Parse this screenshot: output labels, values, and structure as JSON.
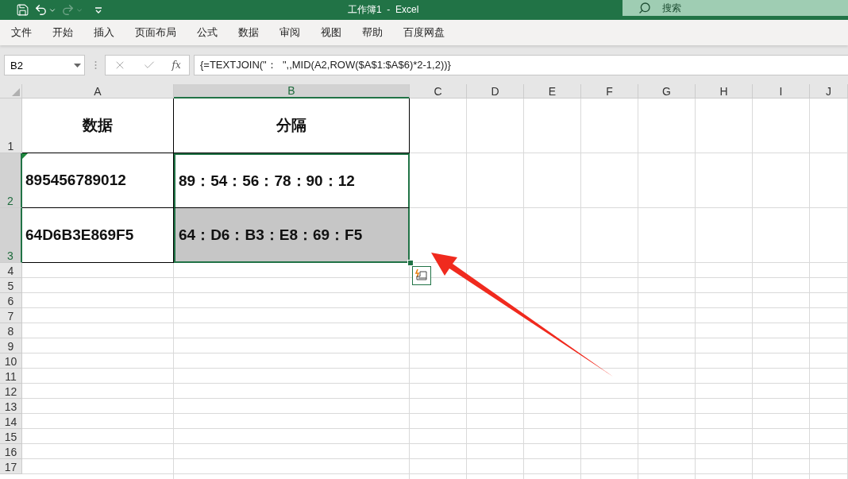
{
  "title_bar": {
    "title": "工作簿1  -  Excel",
    "search_placeholder": "搜索",
    "redo_disabled": true
  },
  "menu": [
    {
      "label": "文件"
    },
    {
      "label": "开始"
    },
    {
      "label": "插入"
    },
    {
      "label": "页面布局"
    },
    {
      "label": "公式"
    },
    {
      "label": "数据"
    },
    {
      "label": "审阅"
    },
    {
      "label": "视图"
    },
    {
      "label": "帮助"
    },
    {
      "label": "百度网盘"
    }
  ],
  "formula_bar": {
    "name_box": "B2",
    "fx": "fx",
    "formula": "{=TEXTJOIN(\"：  \",,MID(A2,ROW($A$1:$A$6)*2-1,2))}"
  },
  "columns": [
    {
      "label": "A",
      "selected": false
    },
    {
      "label": "B",
      "selected": true
    },
    {
      "label": "C",
      "selected": false
    },
    {
      "label": "D",
      "selected": false
    },
    {
      "label": "E",
      "selected": false
    },
    {
      "label": "F",
      "selected": false
    },
    {
      "label": "G",
      "selected": false
    },
    {
      "label": "H",
      "selected": false
    },
    {
      "label": "I",
      "selected": false
    },
    {
      "label": "J",
      "selected": false
    }
  ],
  "rows": [
    {
      "label": "1",
      "selected": false,
      "cells": [
        {
          "text": "数据",
          "kind": "heading",
          "selected": false,
          "shaded": false,
          "flag": false
        },
        {
          "text": "分隔",
          "kind": "heading",
          "selected": false,
          "shaded": false,
          "flag": false
        }
      ]
    },
    {
      "label": "2",
      "selected": true,
      "cells": [
        {
          "text": "895456789012",
          "kind": "value",
          "selected": false,
          "shaded": false,
          "flag": true
        },
        {
          "text": "89：54：56：78：90：12",
          "kind": "value",
          "selected": true,
          "shaded": false,
          "flag": false
        }
      ]
    },
    {
      "label": "3",
      "selected": true,
      "cells": [
        {
          "text": "64D6B3E869F5",
          "kind": "value",
          "selected": false,
          "shaded": false,
          "flag": false
        },
        {
          "text": "64：D6：B3：E8：69：F5",
          "kind": "value",
          "selected": true,
          "shaded": true,
          "flag": false
        }
      ]
    },
    {
      "label": "4",
      "selected": false,
      "cells": []
    },
    {
      "label": "5",
      "selected": false,
      "cells": []
    },
    {
      "label": "6",
      "selected": false,
      "cells": []
    },
    {
      "label": "7",
      "selected": false,
      "cells": []
    },
    {
      "label": "8",
      "selected": false,
      "cells": []
    },
    {
      "label": "9",
      "selected": false,
      "cells": []
    },
    {
      "label": "10",
      "selected": false,
      "cells": []
    },
    {
      "label": "11",
      "selected": false,
      "cells": []
    },
    {
      "label": "12",
      "selected": false,
      "cells": []
    },
    {
      "label": "13",
      "selected": false,
      "cells": []
    },
    {
      "label": "14",
      "selected": false,
      "cells": []
    },
    {
      "label": "15",
      "selected": false,
      "cells": []
    },
    {
      "label": "16",
      "selected": false,
      "cells": []
    },
    {
      "label": "17",
      "selected": false,
      "cells": []
    }
  ]
}
